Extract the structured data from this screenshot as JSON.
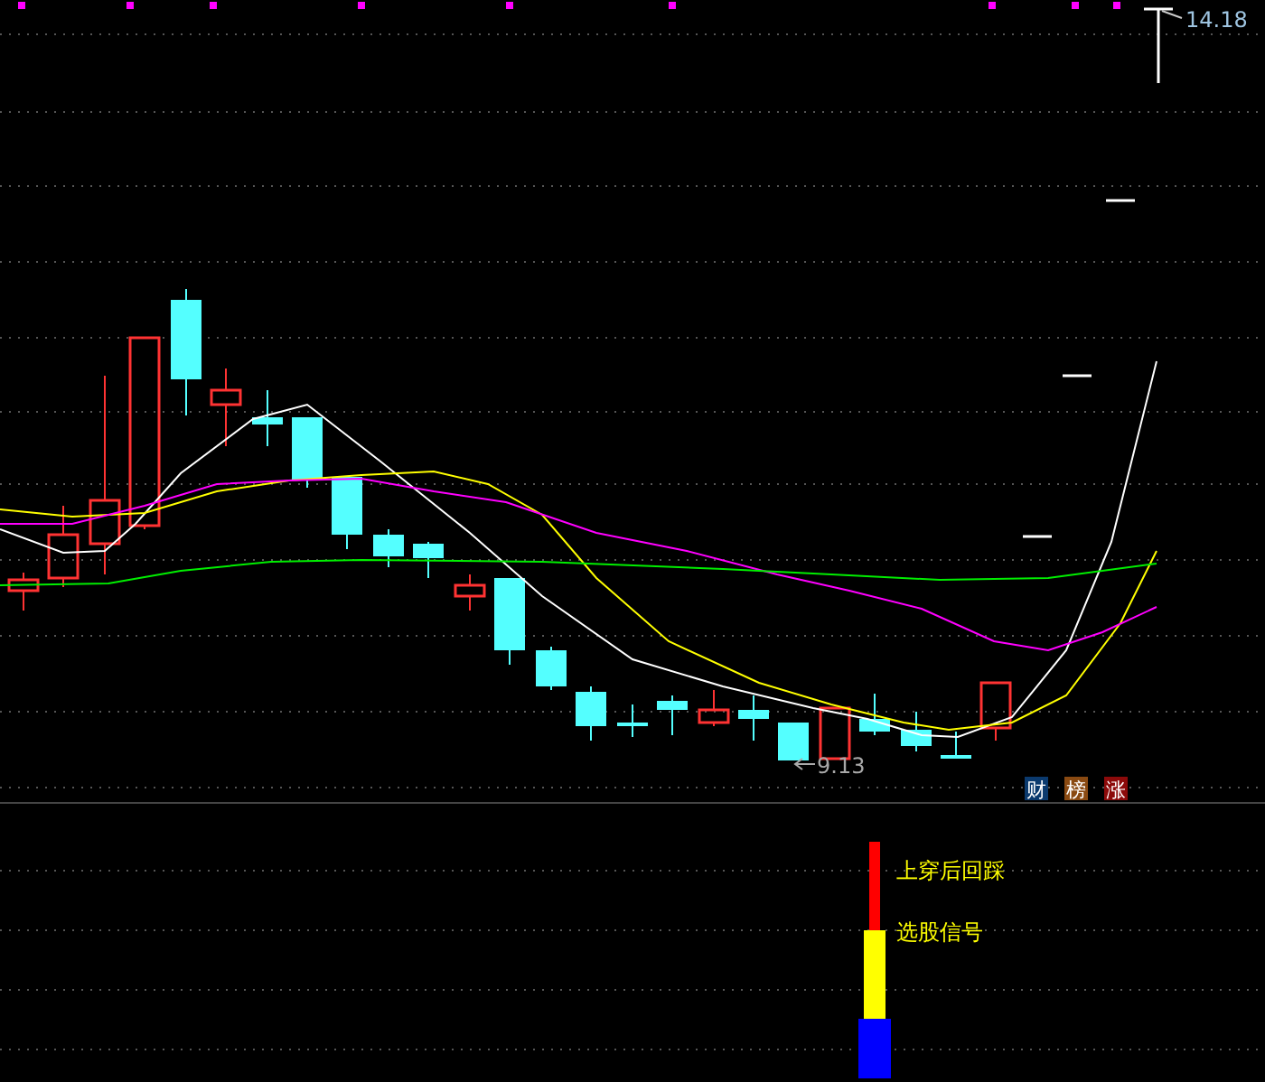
{
  "price_chart": {
    "high_label": "14.18",
    "low_label": "9.13",
    "badges": [
      {
        "label": "财",
        "color": "#0b3a6e"
      },
      {
        "label": "榜",
        "color": "#8a4a12"
      },
      {
        "label": "涨",
        "color": "#8c0a0a"
      }
    ]
  },
  "signal_panel": {
    "signals": [
      {
        "label": "上穿后回踩",
        "color": "#ff0000"
      },
      {
        "label": "选股信号",
        "color": "#ffff00"
      }
    ]
  }
}
